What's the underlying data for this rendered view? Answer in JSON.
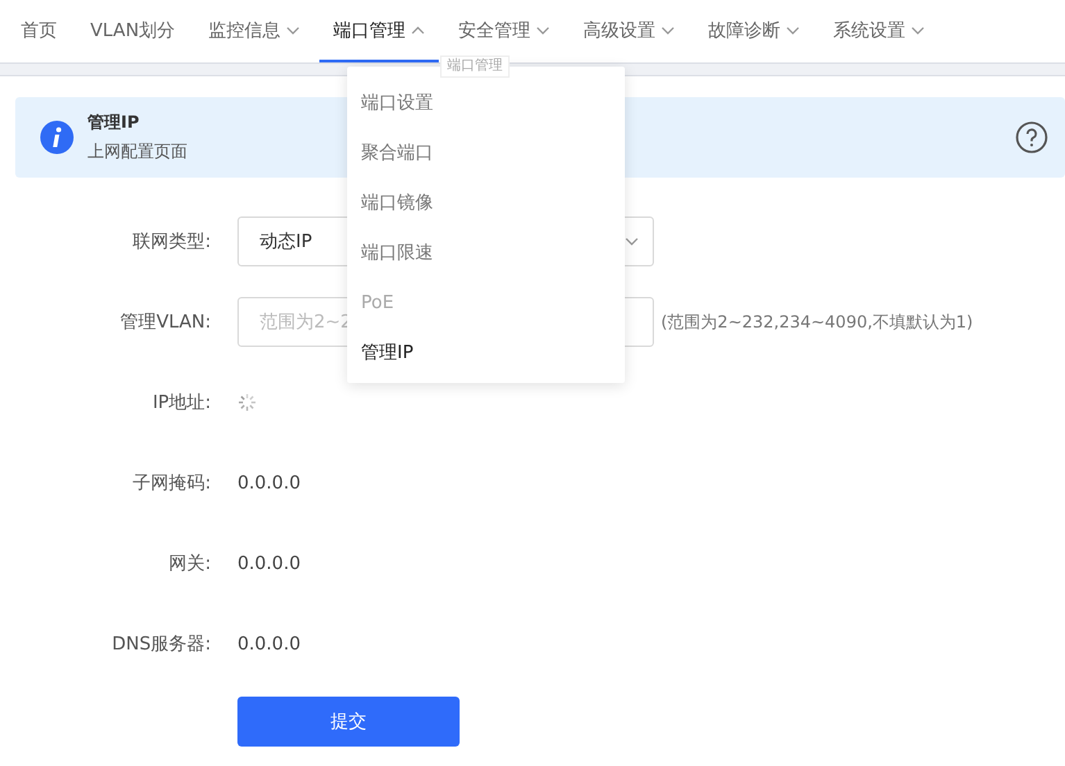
{
  "nav": [
    {
      "label": "首页",
      "has_menu": false,
      "selected": false
    },
    {
      "label": "VLAN划分",
      "has_menu": false,
      "selected": false
    },
    {
      "label": "监控信息",
      "has_menu": true,
      "selected": false
    },
    {
      "label": "端口管理",
      "has_menu": true,
      "selected": true
    },
    {
      "label": "安全管理",
      "has_menu": true,
      "selected": false
    },
    {
      "label": "高级设置",
      "has_menu": true,
      "selected": false
    },
    {
      "label": "故障诊断",
      "has_menu": true,
      "selected": false
    },
    {
      "label": "系统设置",
      "has_menu": true,
      "selected": false
    }
  ],
  "tooltip": "端口管理",
  "menu": [
    {
      "label": "端口设置",
      "selected": false,
      "disabled": false
    },
    {
      "label": "聚合端口",
      "selected": false,
      "disabled": false
    },
    {
      "label": "端口镜像",
      "selected": false,
      "disabled": false
    },
    {
      "label": "端口限速",
      "selected": false,
      "disabled": false
    },
    {
      "label": "PoE",
      "selected": false,
      "disabled": true
    },
    {
      "label": "管理IP",
      "selected": true,
      "disabled": false
    }
  ],
  "banner": {
    "title": "管理IP",
    "subtitle": "上网配置页面"
  },
  "form": [
    {
      "kind": "select",
      "label": "联网类型:",
      "value": "动态IP"
    },
    {
      "kind": "input",
      "label": "管理VLAN:",
      "placeholder": "范围为2~2",
      "hint": "(范围为2~232,234~4090,不填默认为1)"
    },
    {
      "kind": "loading",
      "label": "IP地址:"
    },
    {
      "kind": "text",
      "label": "子网掩码:",
      "value": "0.0.0.0"
    },
    {
      "kind": "text",
      "label": "网关:",
      "value": "0.0.0.0"
    },
    {
      "kind": "text",
      "label": "DNS服务器:",
      "value": "0.0.0.0"
    }
  ],
  "submit": "提交"
}
